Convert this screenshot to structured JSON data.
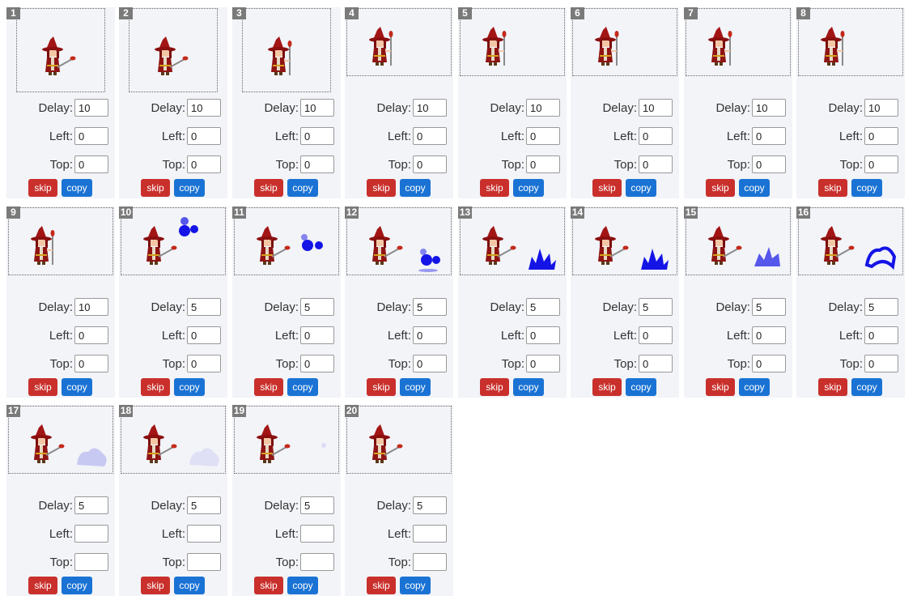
{
  "labels": {
    "delay": "Delay:",
    "left": "Left:",
    "top": "Top:",
    "skip": "skip",
    "copy": "copy"
  },
  "frames": [
    {
      "n": "1",
      "delay": "10",
      "left": "0",
      "top": "0",
      "thumb": "tall",
      "fx": "staff-low"
    },
    {
      "n": "2",
      "delay": "10",
      "left": "0",
      "top": "0",
      "thumb": "tall",
      "fx": "staff-low"
    },
    {
      "n": "3",
      "delay": "10",
      "left": "0",
      "top": "0",
      "thumb": "tall",
      "fx": "staff-up"
    },
    {
      "n": "4",
      "delay": "10",
      "left": "0",
      "top": "0",
      "thumb": "wide",
      "fx": "staff-up"
    },
    {
      "n": "5",
      "delay": "10",
      "left": "0",
      "top": "0",
      "thumb": "wide",
      "fx": "staff-up"
    },
    {
      "n": "6",
      "delay": "10",
      "left": "0",
      "top": "0",
      "thumb": "wide",
      "fx": "staff-up"
    },
    {
      "n": "7",
      "delay": "10",
      "left": "0",
      "top": "0",
      "thumb": "wide",
      "fx": "staff-up"
    },
    {
      "n": "8",
      "delay": "10",
      "left": "0",
      "top": "0",
      "thumb": "wide",
      "fx": "staff-up"
    },
    {
      "n": "9",
      "delay": "10",
      "left": "0",
      "top": "0",
      "thumb": "wide",
      "fx": "staff-up"
    },
    {
      "n": "10",
      "delay": "5",
      "left": "0",
      "top": "0",
      "thumb": "wide",
      "fx": "orb-high"
    },
    {
      "n": "11",
      "delay": "5",
      "left": "0",
      "top": "0",
      "thumb": "wide",
      "fx": "orb-mid"
    },
    {
      "n": "12",
      "delay": "5",
      "left": "0",
      "top": "0",
      "thumb": "wide",
      "fx": "orb-low"
    },
    {
      "n": "13",
      "delay": "5",
      "left": "0",
      "top": "0",
      "thumb": "wide",
      "fx": "burst"
    },
    {
      "n": "14",
      "delay": "5",
      "left": "0",
      "top": "0",
      "thumb": "wide",
      "fx": "burst"
    },
    {
      "n": "15",
      "delay": "5",
      "left": "0",
      "top": "0",
      "thumb": "wide",
      "fx": "burst-fade"
    },
    {
      "n": "16",
      "delay": "5",
      "left": "0",
      "top": "0",
      "thumb": "wide",
      "fx": "ring"
    },
    {
      "n": "17",
      "delay": "5",
      "left": "",
      "top": "",
      "thumb": "wide",
      "fx": "smoke"
    },
    {
      "n": "18",
      "delay": "5",
      "left": "",
      "top": "",
      "thumb": "wide",
      "fx": "smoke-fade"
    },
    {
      "n": "19",
      "delay": "5",
      "left": "",
      "top": "",
      "thumb": "wide",
      "fx": "faint"
    },
    {
      "n": "20",
      "delay": "5",
      "left": "",
      "top": "",
      "thumb": "wide",
      "fx": "none"
    }
  ]
}
